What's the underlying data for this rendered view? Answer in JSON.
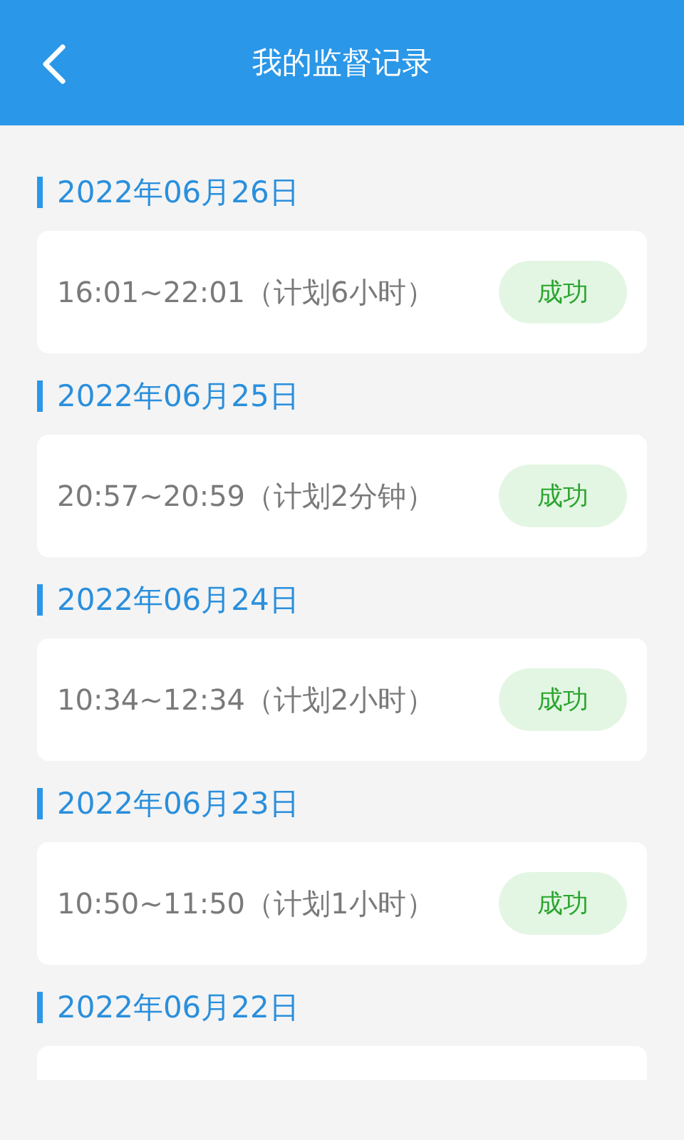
{
  "header": {
    "title": "我的监督记录"
  },
  "days": [
    {
      "date": "2022年06月26日",
      "record": {
        "time": "16:01~22:01（计划6小时）",
        "status": "成功"
      }
    },
    {
      "date": "2022年06月25日",
      "record": {
        "time": "20:57~20:59（计划2分钟）",
        "status": "成功"
      }
    },
    {
      "date": "2022年06月24日",
      "record": {
        "time": "10:34~12:34（计划2小时）",
        "status": "成功"
      }
    },
    {
      "date": "2022年06月23日",
      "record": {
        "time": "10:50~11:50（计划1小时）",
        "status": "成功"
      }
    },
    {
      "date": "2022年06月22日",
      "partial": true
    }
  ]
}
